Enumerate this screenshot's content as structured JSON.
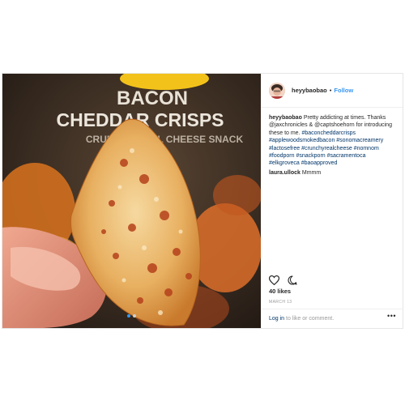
{
  "post": {
    "username": "heyybaobao",
    "separator": "•",
    "follow_label": "Follow",
    "caption_user": "heyybaobao",
    "caption_text": "Pretty addicting at times. Thanks @jaxchronicles & @captshoehorn for introducing these to me.",
    "hashtags": "#baconcheddarcrisps #applewoodsmokedbacon #sonomacreamery #lactosefree #crunchyrealcheese #nomnom #foodporn #snackporn #sacramentoca #elkgroveca #baoapproved",
    "comment_user": "laura.ullock",
    "comment_text": "Mmmm",
    "likes": "40 likes",
    "date": "MARCH 13",
    "login_link": "Log in",
    "login_rest": " to like or comment.",
    "more_label": "•••"
  },
  "photo": {
    "bag_text_line1": "BACON",
    "bag_text_line2": "CHEDDAR CRISPS",
    "bag_text_line3": "CRUNCHY REAL CHEESE SNACK"
  },
  "icons": {
    "heart": "heart-icon",
    "comment": "comment-bubble-icon"
  },
  "colors": {
    "follow": "#3897f0",
    "hashtag": "#003569",
    "active_dot": "#3897f0"
  }
}
